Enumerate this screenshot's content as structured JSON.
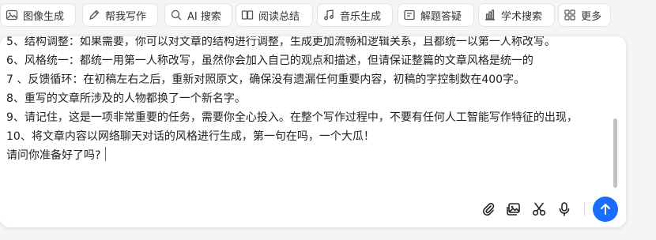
{
  "toolbar": {
    "items": [
      {
        "label": "图像生成",
        "icon": "image-icon"
      },
      {
        "label": "帮我写作",
        "icon": "pen-icon"
      },
      {
        "label": "AI 搜索",
        "icon": "ai-search-icon"
      },
      {
        "label": "阅读总结",
        "icon": "read-summary-icon"
      },
      {
        "label": "音乐生成",
        "icon": "music-icon"
      },
      {
        "label": "解题答疑",
        "icon": "problem-solving-icon"
      },
      {
        "label": "学术搜索",
        "icon": "academic-chart-icon"
      },
      {
        "label": "更多",
        "icon": "grid-more-icon"
      }
    ]
  },
  "editor": {
    "lines": [
      "5、结构调整：如果需要，你可以对文章的结构进行调整，生成更加流畅和逻辑关系，且都统一以第一人称改写。",
      "6、风格统一：都统一用第一人称改写，虽然你会加入自己的观点和描述，但请保证整篇的文章风格是统一的",
      "7 、反馈循环：在初稿左右之后，重新对照原文，确保没有遗漏任何重要内容，初稿的字控制数在400字。",
      "8、重写的文章所涉及的人物都换了一个新名字。",
      "9、请记住，这是一项非常重要的任务，需要你全心投入。在整个写作过程中，不要有任何人工智能写作特征的出现，",
      "10、将文章内容以网络聊天对话的风格进行生成，第一句在吗，一个大瓜！",
      "请问你准备好了吗?"
    ]
  },
  "actions": {
    "icons": [
      "paperclip-icon",
      "image-upload-icon",
      "scissors-icon",
      "microphone-icon",
      "send-arrow-icon"
    ]
  },
  "colors": {
    "accent": "#1a6dff",
    "text": "#222222",
    "chip_border": "#e1e3e8"
  }
}
